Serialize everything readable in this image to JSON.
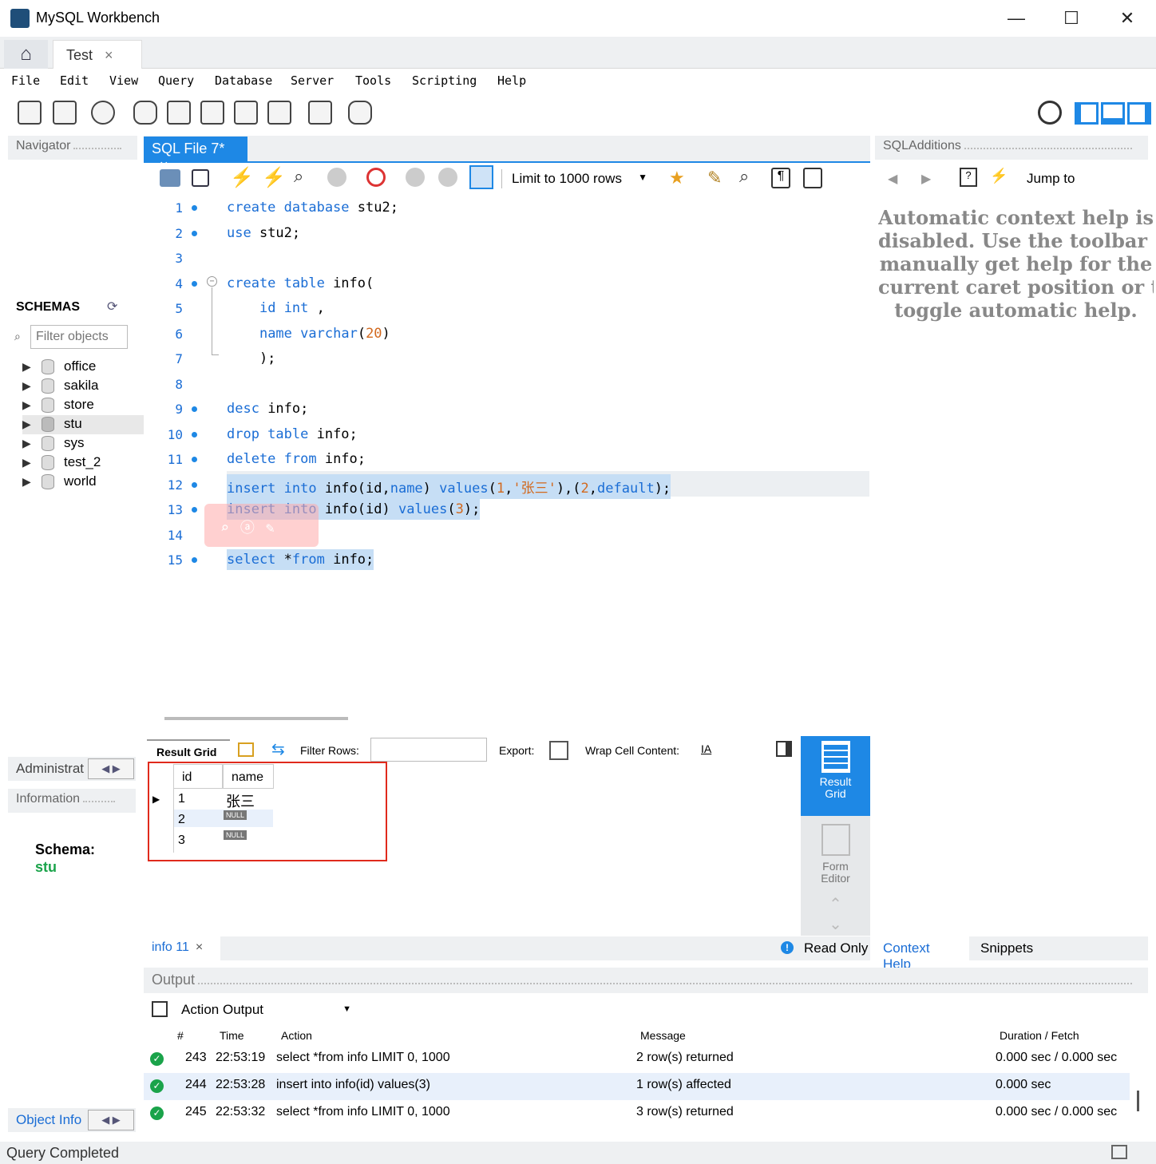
{
  "window": {
    "title": "MySQL Workbench",
    "minimize": "—",
    "maximize": "☐",
    "close": "✕"
  },
  "tabs": {
    "home_icon": "home-icon",
    "connection": "Test",
    "close": "×"
  },
  "menu": [
    "File",
    "Edit",
    "View",
    "Query",
    "Database",
    "Server",
    "Tools",
    "Scripting",
    "Help"
  ],
  "navigator": {
    "header": "Navigator",
    "schemas_label": "SCHEMAS",
    "filter_placeholder": "Filter objects",
    "schemas": [
      "office",
      "sakila",
      "store",
      "stu",
      "sys",
      "test_2",
      "world"
    ],
    "selected_schema": "stu",
    "admin_tab": "Administrat",
    "information_header": "Information",
    "schema_label": "Schema:",
    "schema_value": "stu",
    "object_info_tab": "Object Info"
  },
  "editor": {
    "tab_label": "SQL File 7*",
    "tab_close": "×",
    "limit_label": "Limit to 1000 rows",
    "line_numbers": [
      "1",
      "2",
      "3",
      "4",
      "5",
      "6",
      "7",
      "8",
      "9",
      "10",
      "11",
      "12",
      "13",
      "14",
      "15"
    ]
  },
  "result": {
    "tab_result_grid": "Result Grid",
    "filter_rows": "Filter Rows:",
    "export": "Export:",
    "wrap": "Wrap Cell Content:",
    "columns": [
      "id",
      "name"
    ],
    "rows": [
      [
        "1",
        "张三"
      ],
      [
        "2",
        "NULL"
      ],
      [
        "3",
        "NULL"
      ]
    ],
    "side_result_grid": "Result Grid",
    "side_form_editor": "Form Editor",
    "footer_tab": "info 11",
    "read_only": "Read Only"
  },
  "sql_additions": {
    "header": "SQLAdditions",
    "jump_to": "Jump to",
    "help_lines": [
      "Automatic context help is",
      "disabled. Use the toolbar t",
      "manually get help for the",
      "current caret position or to",
      "toggle automatic help."
    ],
    "tab_context_help": "Context Help",
    "tab_snippets": "Snippets"
  },
  "output": {
    "header": "Output",
    "dropdown": "Action Output",
    "columns": [
      "#",
      "Time",
      "Action",
      "Message",
      "Duration / Fetch"
    ],
    "rows": [
      {
        "n": "243",
        "time": "22:53:19",
        "action": "select *from info LIMIT 0, 1000",
        "message": "2 row(s) returned",
        "duration": "0.000 sec / 0.000 sec"
      },
      {
        "n": "244",
        "time": "22:53:28",
        "action": "insert into info(id) values(3)",
        "message": "1 row(s) affected",
        "duration": "0.000 sec"
      },
      {
        "n": "245",
        "time": "22:53:32",
        "action": "select *from info LIMIT 0, 1000",
        "message": "3 row(s) returned",
        "duration": "0.000 sec / 0.000 sec"
      }
    ]
  },
  "status": "Query Completed"
}
